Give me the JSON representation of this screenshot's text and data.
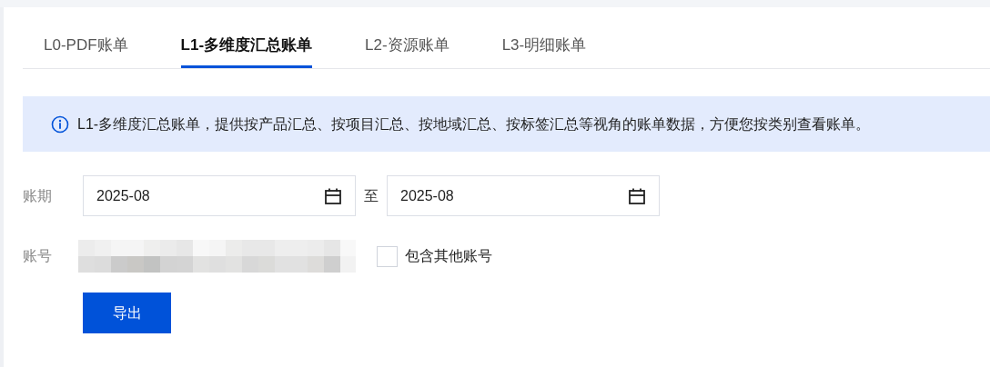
{
  "tabs": [
    {
      "label": "L0-PDF账单",
      "selected": false
    },
    {
      "label": "L1-多维度汇总账单",
      "selected": true
    },
    {
      "label": "L2-资源账单",
      "selected": false
    },
    {
      "label": "L3-明细账单",
      "selected": false
    }
  ],
  "notice": {
    "text": "L1-多维度汇总账单，提供按产品汇总、按项目汇总、按地域汇总、按标签汇总等视角的账单数据，方便您按类别查看账单。"
  },
  "period": {
    "label": "账期",
    "start": "2025-08",
    "separator": "至",
    "end": "2025-08"
  },
  "account": {
    "label": "账号",
    "value": {
      "kind": "blurred"
    },
    "include_others": {
      "label": "包含其他账号",
      "checked": false
    }
  },
  "export_button": "导出"
}
